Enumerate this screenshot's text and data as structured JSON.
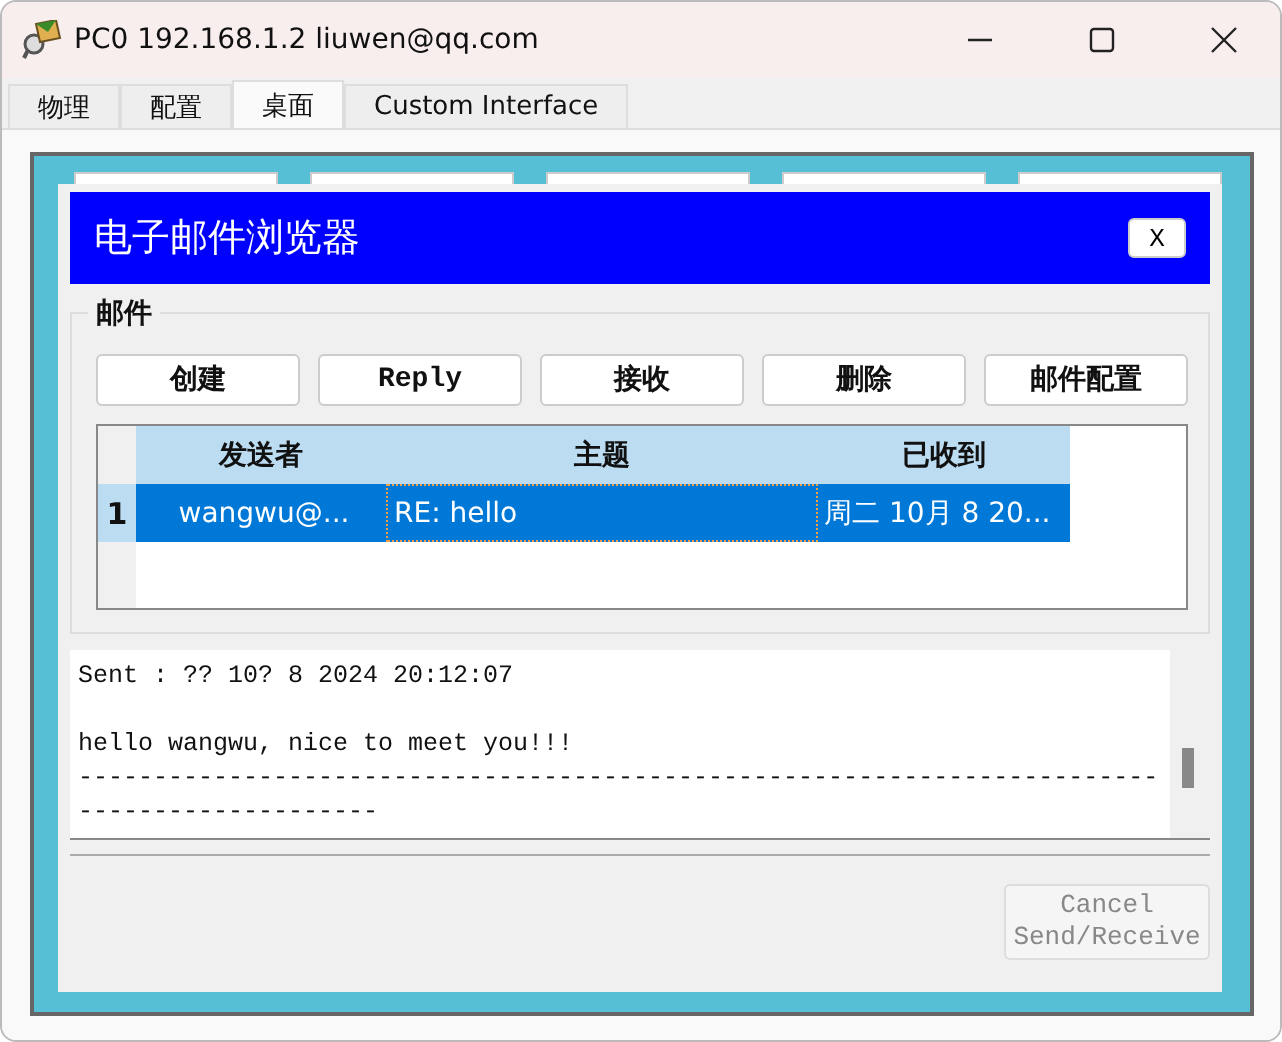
{
  "window": {
    "title": "PC0 192.168.1.2 liuwen@qq.com"
  },
  "tabs": [
    {
      "label": "物理",
      "selected": false
    },
    {
      "label": "配置",
      "selected": false
    },
    {
      "label": "桌面",
      "selected": true
    },
    {
      "label": "Custom Interface",
      "selected": false
    }
  ],
  "browser": {
    "title": "电子邮件浏览器",
    "close_label": "X"
  },
  "mail": {
    "group_label": "邮件",
    "buttons": [
      "创建",
      "Reply",
      "接收",
      "删除",
      "邮件配置"
    ],
    "table": {
      "columns": [
        "发送者",
        "主题",
        "已收到"
      ],
      "rows": [
        {
          "number": "1",
          "cells": [
            "wangwu@...",
            "RE: hello",
            "周二 10月 8 20..."
          ],
          "selected": true
        }
      ]
    }
  },
  "message": {
    "lines": [
      "Sent : ?? 10? 8 2024 20:12:07",
      "hello wangwu, nice to meet you!!!",
      "------------------------------------------------------------------------",
      "--------------------"
    ]
  },
  "cancel_button": {
    "label": "Cancel\nSend/Receive",
    "disabled": true
  }
}
